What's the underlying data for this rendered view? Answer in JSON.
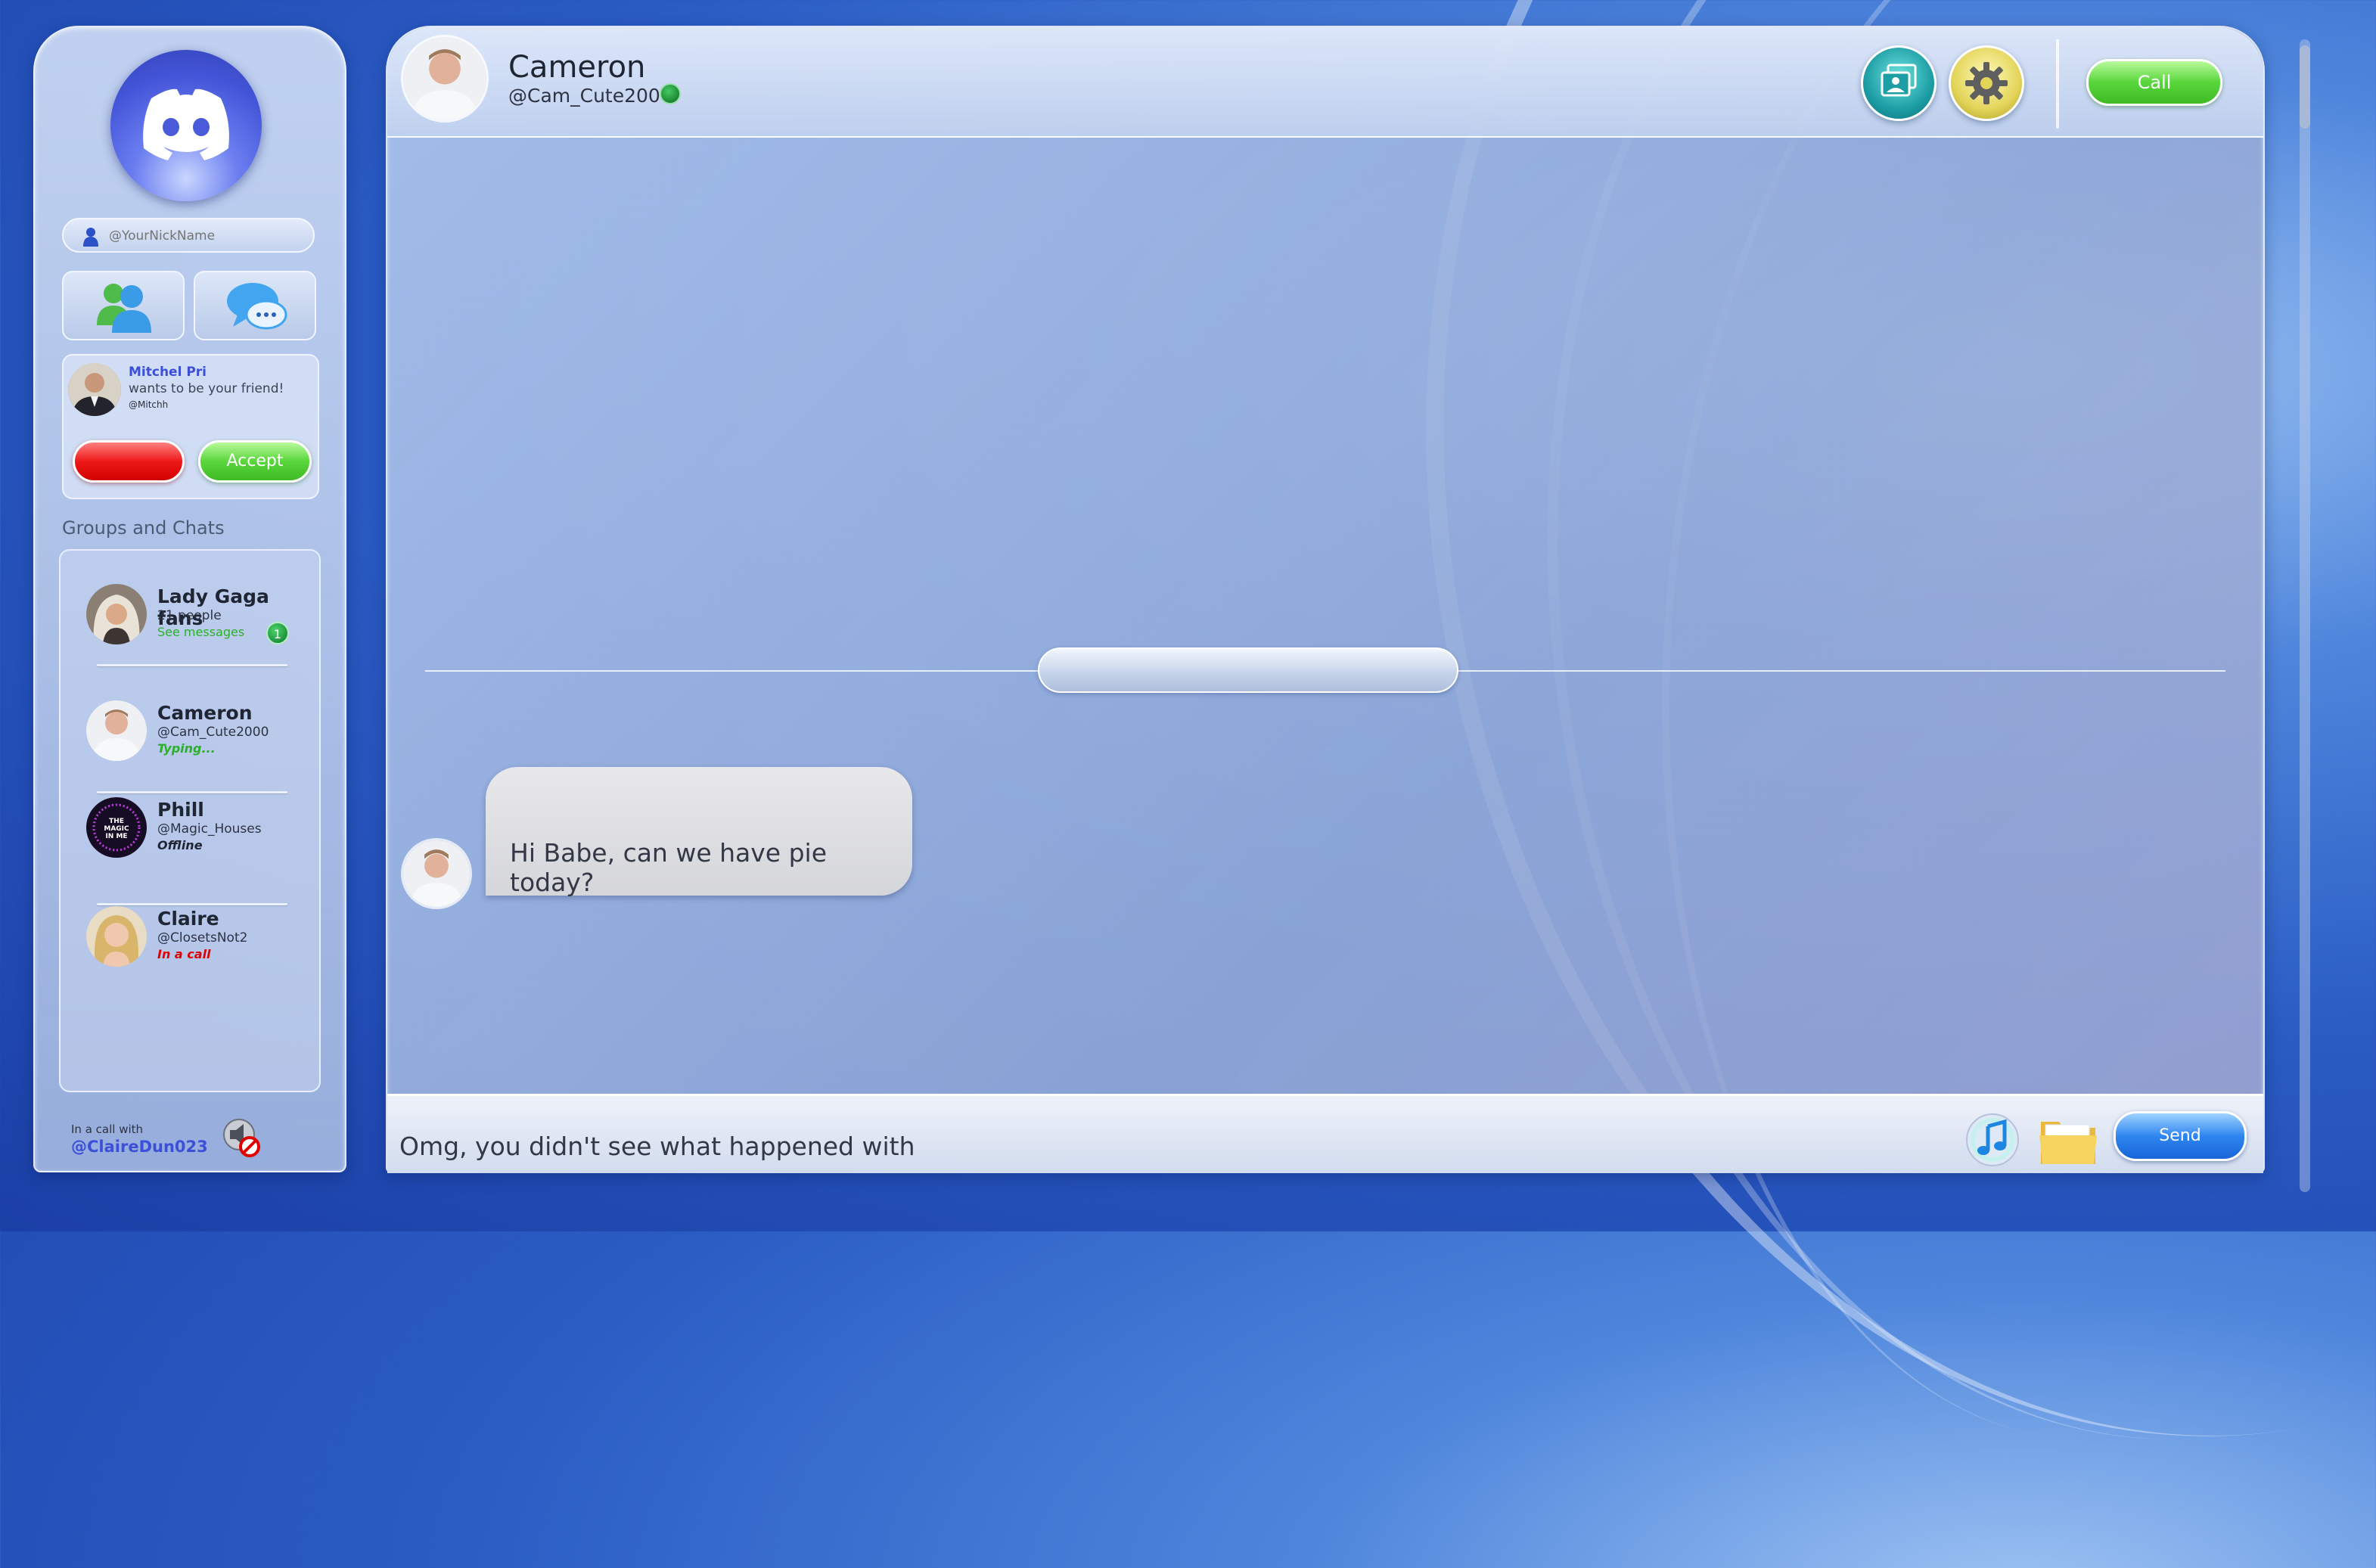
{
  "sidebar": {
    "nickname_placeholder": "@YourNickName",
    "friend_request": {
      "name": "Mitchel Pri",
      "message": "wants to be your friend!",
      "handle": "@Mitchh",
      "decline_label": "",
      "accept_label": "Accept"
    },
    "groups_heading": "Groups and Chats",
    "chats": [
      {
        "name": "Lady Gaga fans",
        "subtitle": "21 people",
        "status": "See messages",
        "unread": "1"
      },
      {
        "name": "Cameron",
        "subtitle": "@Cam_Cute2000",
        "status": "Typing..."
      },
      {
        "name": "Phill",
        "subtitle": "@Magic_Houses",
        "status": "Offline"
      },
      {
        "name": "Claire",
        "subtitle": "@ClosetsNot2",
        "status": "In a call"
      }
    ],
    "call": {
      "label": "In a call with",
      "user": "@ClaireDun023"
    }
  },
  "header": {
    "name": "Cameron",
    "handle": "@Cam_Cute2000",
    "call_label": "Call"
  },
  "conversation": {
    "messages": [
      {
        "text": "Hi Babe, can we have pie today?"
      }
    ]
  },
  "composer": {
    "value": "Omg, you didn't see what happened with",
    "send_label": "Send"
  },
  "colors": {
    "accent_blue": "#3b4fd8",
    "online": "#0c8a2c",
    "typing": "#2bb02b",
    "in_call": "#e00000",
    "see_messages": "#2bb02b"
  },
  "icons": [
    "discord-logo-icon",
    "user-icon",
    "friends-icon",
    "chat-bubble-icon",
    "gallery-icon",
    "gear-icon",
    "music-icon",
    "folder-icon",
    "muted-speaker-icon"
  ]
}
